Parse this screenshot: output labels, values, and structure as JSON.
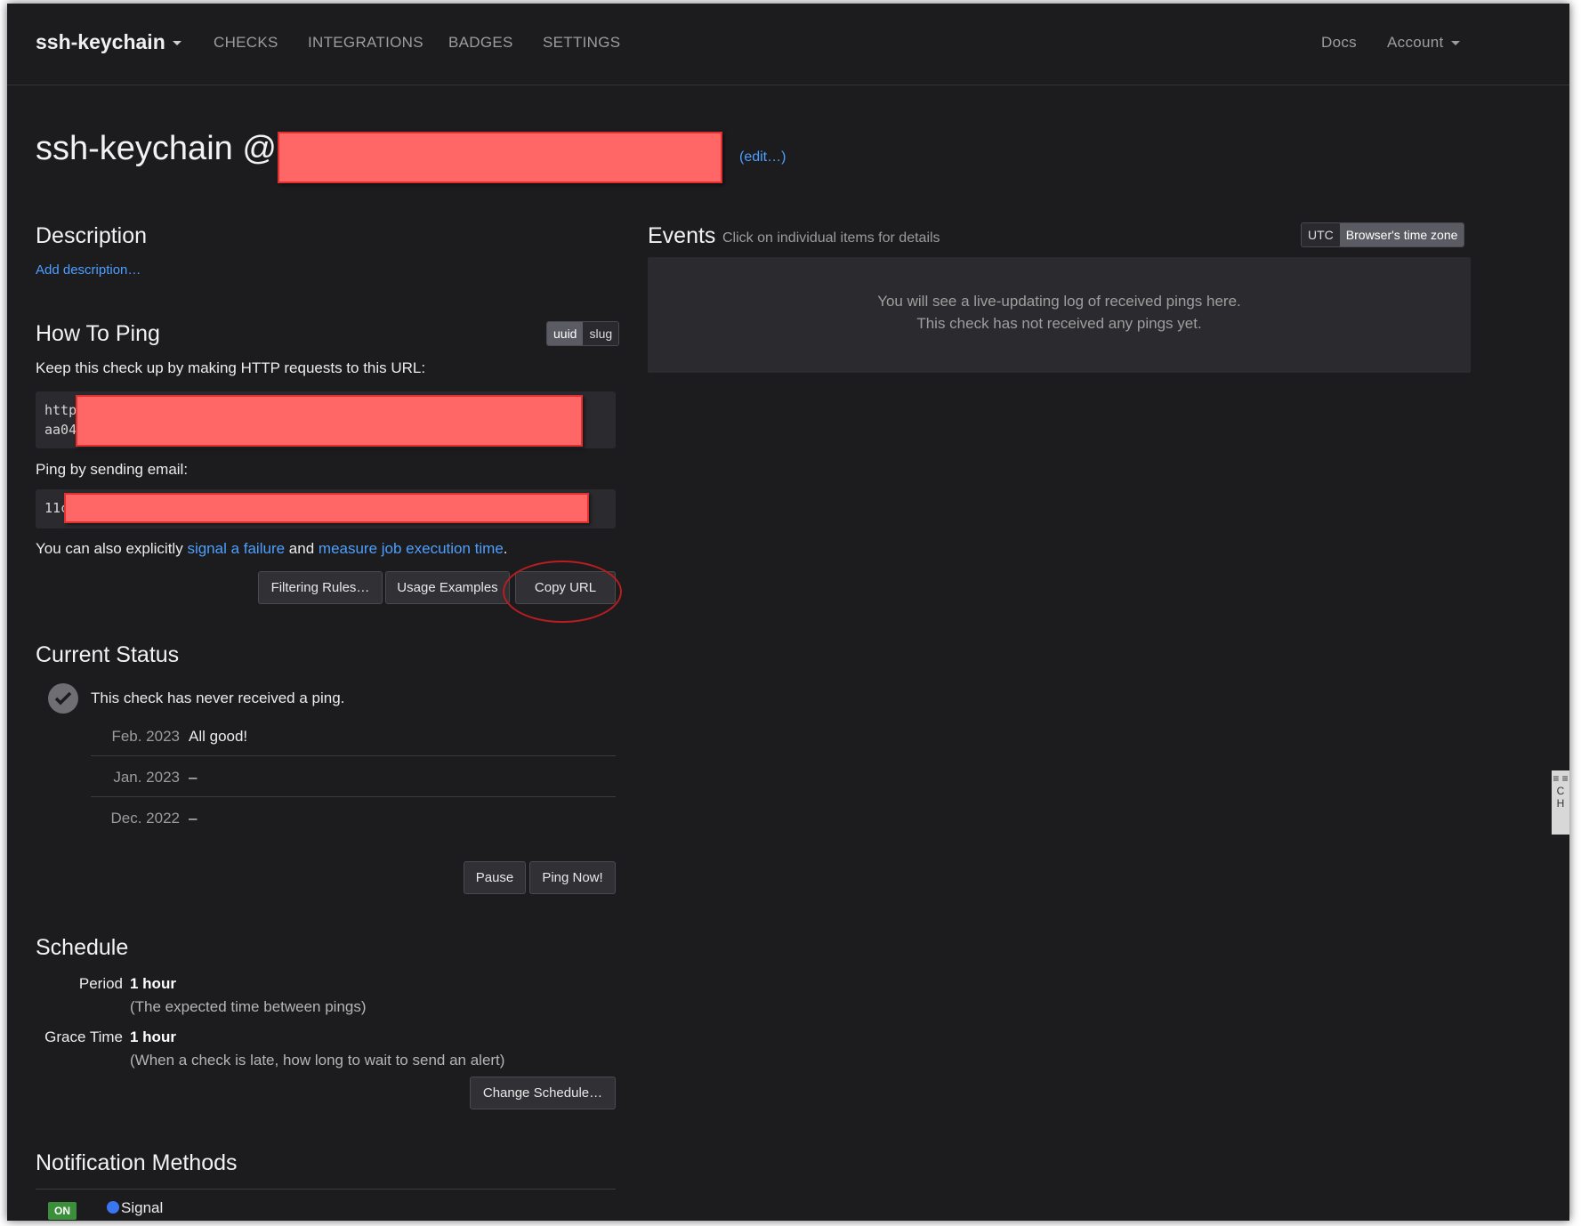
{
  "navbar": {
    "brand": "ssh-keychain",
    "items": [
      "CHECKS",
      "INTEGRATIONS",
      "BADGES",
      "SETTINGS"
    ],
    "docs": "Docs",
    "account": "Account"
  },
  "title": {
    "prefix": "ssh-keychain @",
    "edit": "(edit…)"
  },
  "description": {
    "heading": "Description",
    "add": "Add description…"
  },
  "ping": {
    "heading": "How To Ping",
    "toggle": [
      "uuid",
      "slug"
    ],
    "intro": "Keep this check up by making HTTP requests to this URL:",
    "url_line1": "http",
    "url_line2": "aa04",
    "email_label": "Ping by sending email:",
    "email_value": "11c",
    "also_prefix": "You can also explicitly",
    "signal_failure": "signal a failure",
    "and": "and",
    "measure": "measure job execution time",
    "period": ".",
    "buttons": {
      "filtering": "Filtering Rules…",
      "usage": "Usage Examples",
      "copy": "Copy URL"
    }
  },
  "status": {
    "heading": "Current Status",
    "message": "This check has never received a ping.",
    "rows": [
      {
        "month": "Feb. 2023",
        "value": "All good!"
      },
      {
        "month": "Jan. 2023",
        "value": "–"
      },
      {
        "month": "Dec. 2022",
        "value": "–"
      }
    ],
    "pause": "Pause",
    "ping_now": "Ping Now!"
  },
  "schedule": {
    "heading": "Schedule",
    "period_label": "Period",
    "period_value": "1 hour",
    "period_note": "(The expected time between pings)",
    "grace_label": "Grace Time",
    "grace_value": "1 hour",
    "grace_note": "(When a check is late, how long to wait to send an alert)",
    "change": "Change Schedule…"
  },
  "notifications": {
    "heading": "Notification Methods",
    "badge": "ON",
    "method": "Signal"
  },
  "events": {
    "heading": "Events",
    "hint": "Click on individual items for details",
    "tz_toggle": [
      "UTC",
      "Browser's time zone"
    ],
    "empty_line1": "You will see a live-updating log of received pings here.",
    "empty_line2": "This check has not received any pings yet."
  },
  "side_tab": "≡ ≡ C H"
}
